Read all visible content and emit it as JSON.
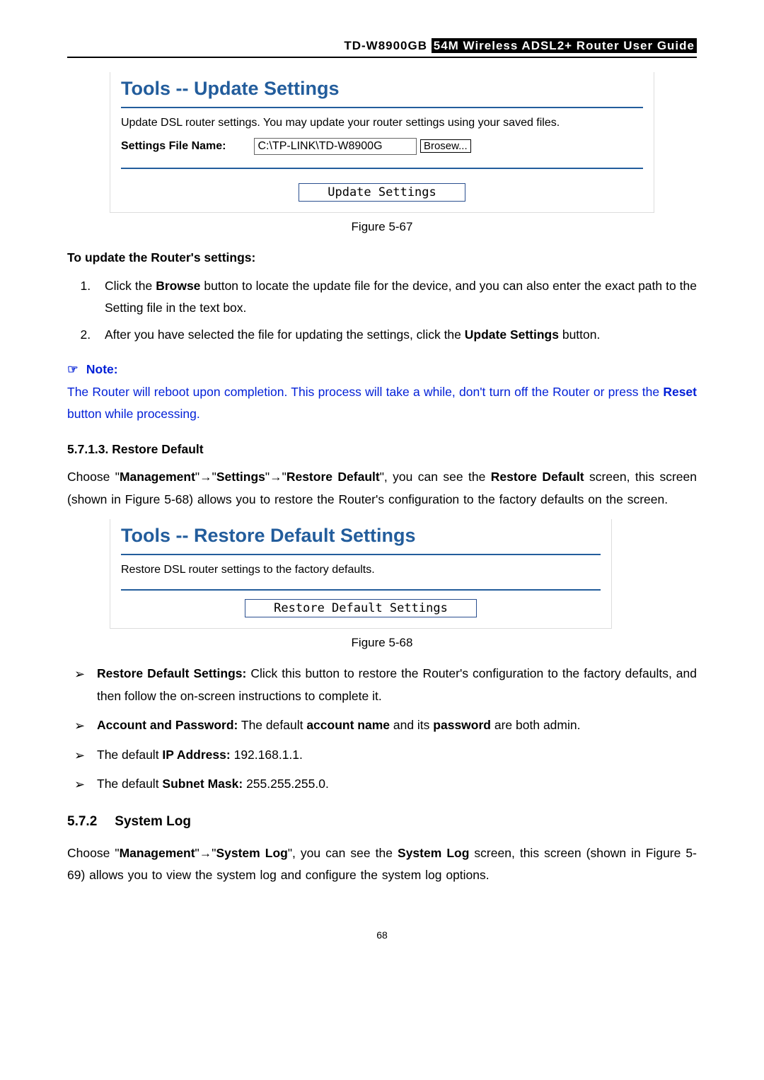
{
  "header": {
    "model": "TD-W8900GB",
    "title_rest": "54M  Wireless  ADSL2+  Router  User  Guide"
  },
  "fig1": {
    "title": "Tools -- Update Settings",
    "desc": "Update DSL router settings. You may update your router settings using your saved files.",
    "field_label": "Settings File Name:",
    "file_value": "C:\\TP-LINK\\TD-W8900G",
    "browse_label": "Brosew...",
    "button_label": "Update Settings",
    "caption": "Figure 5-67"
  },
  "steps_heading": "To update the Router's settings:",
  "steps": {
    "1": {
      "pre": "Click the ",
      "b1": "Browse",
      "post": " button to locate the update file for the device, and you can also enter the exact path to the Setting file in the text box."
    },
    "2": {
      "pre": "After you have selected the file for updating the settings, click the ",
      "b1": "Update Settings",
      "post": " button."
    }
  },
  "note": {
    "label": "Note:",
    "text_pre": "The Router will reboot upon completion. This process will take a while, don't turn off the Router or press the ",
    "text_bold": "Reset",
    "text_post": " button while processing."
  },
  "section_restore": {
    "num": "5.7.1.3.  Restore Default",
    "para_pre": "Choose  \"",
    "mgmt": "Management",
    "arrow": "→",
    "settings": "Settings",
    "restore": "Restore  Default",
    "para_mid1": "\",  you  can  see  the  ",
    "rd_bold": "Restore  Default",
    "para_post": " screen, this screen (shown in Figure 5-68) allows you to restore the Router's configuration to the factory defaults on the screen."
  },
  "fig2": {
    "title": "Tools -- Restore Default Settings",
    "desc": "Restore DSL router settings to the factory defaults.",
    "button_label": "Restore Default Settings",
    "caption": "Figure 5-68"
  },
  "bullets": {
    "0": {
      "b": "Restore  Default  Settings:",
      "rest": " Click  this  button  to  restore  the  Router's  configuration  to  the factory defaults, and then follow the on-screen instructions to complete it."
    },
    "1": {
      "b": "Account and Password:",
      "mid1": " The default ",
      "b2": "account name",
      "mid2": " and its ",
      "b3": "password",
      "rest": " are both admin."
    },
    "2": {
      "pre": "The default ",
      "b": "IP Address:",
      "rest": " 192.168.1.1."
    },
    "3": {
      "pre": "The default ",
      "b": "Subnet Mask:",
      "rest": " 255.255.255.0."
    }
  },
  "section_syslog": {
    "num": "5.7.2",
    "title": "System Log",
    "para_pre": "Choose  \"",
    "mgmt": "Management",
    "arrow": "→",
    "syslog": "System  Log",
    "mid": "\",  you  can  see  the  ",
    "sl_bold": "System  Log",
    "post": "  screen,  this  screen (shown in Figure 5-69) allows you to view the system log and configure the system log options."
  },
  "page_number": "68"
}
